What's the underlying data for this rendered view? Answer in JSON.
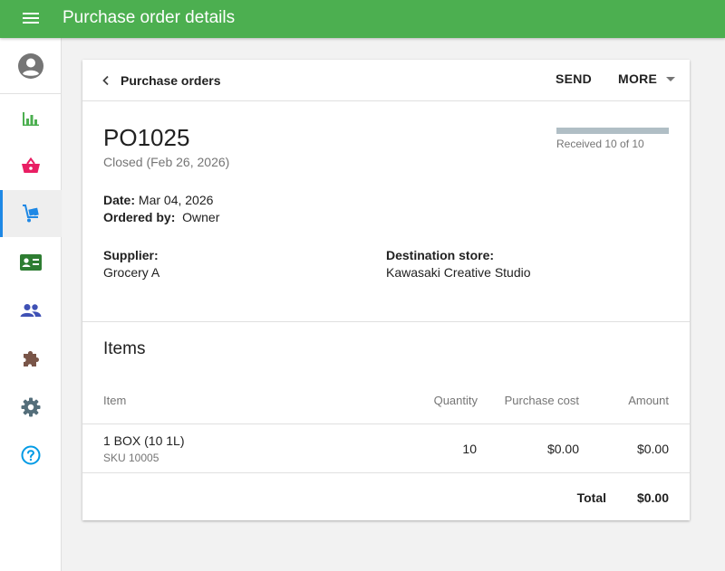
{
  "app": {
    "title": "Purchase order details"
  },
  "colors": {
    "topbar": "#4caf50",
    "active_indicator": "#1e88e5"
  },
  "sidebar": {
    "items": [
      {
        "icon": "reports-icon",
        "color": "#4caf50"
      },
      {
        "icon": "basket-icon",
        "color": "#e91e63"
      },
      {
        "icon": "inventory-cart-icon",
        "color": "#1e88e5",
        "active": true
      },
      {
        "icon": "employee-card-icon",
        "color": "#2e7d32"
      },
      {
        "icon": "customers-icon",
        "color": "#3f51b5"
      },
      {
        "icon": "integrations-puzzle-icon",
        "color": "#795548"
      },
      {
        "icon": "settings-gear-icon",
        "color": "#546e7a"
      },
      {
        "icon": "help-icon",
        "color": "#039be5"
      }
    ]
  },
  "header": {
    "back_label": "Purchase orders",
    "send_label": "SEND",
    "more_label": "MORE"
  },
  "po": {
    "number": "PO1025",
    "status": "Closed (Feb 26, 2026)",
    "received_text": "Received 10 of 10",
    "received_fraction": 1.0,
    "date_label": "Date:",
    "date_value": "Mar 04, 2026",
    "ordered_by_label": "Ordered by:",
    "ordered_by_value": "Owner",
    "supplier_label": "Supplier:",
    "supplier_value": "Grocery A",
    "destination_label": "Destination store:",
    "destination_value": "Kawasaki Creative Studio"
  },
  "items": {
    "title": "Items",
    "columns": {
      "item": "Item",
      "quantity": "Quantity",
      "cost": "Purchase cost",
      "amount": "Amount"
    },
    "rows": [
      {
        "name": "1 BOX (10 1L)",
        "sku": "SKU 10005",
        "quantity": "10",
        "cost": "$0.00",
        "amount": "$0.00"
      }
    ],
    "total_label": "Total",
    "total_value": "$0.00"
  }
}
